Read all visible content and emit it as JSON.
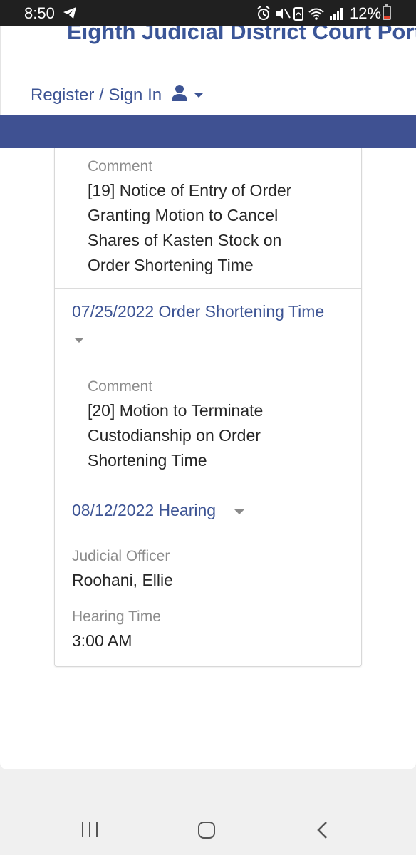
{
  "status_bar": {
    "time": "8:50",
    "battery": "12%",
    "icons": [
      "telegram-icon",
      "alarm-icon",
      "mute-icon",
      "nfc-icon",
      "wifi-icon",
      "signal-icon",
      "battery-icon"
    ]
  },
  "header": {
    "site_title": "Eighth Judicial District Court Portal",
    "signin_label": "Register / Sign In"
  },
  "colors": {
    "brand_blue": "#3f5192",
    "link_blue": "#3d5494"
  },
  "events": [
    {
      "comment_label": "Comment",
      "comment_lines": [
        "[19] Notice of Entry of Order",
        "Granting Motion to Cancel",
        "Shares of Kasten Stock on",
        "Order Shortening Time"
      ]
    },
    {
      "title": "07/25/2022 Order Shortening Time",
      "comment_label": "Comment",
      "comment_lines": [
        "[20] Motion to Terminate",
        "Custodianship on Order",
        "Shortening Time"
      ]
    },
    {
      "title": "08/12/2022 Hearing",
      "officer_label": "Judicial Officer",
      "officer_value": "Roohani, Ellie",
      "time_label": "Hearing Time",
      "time_value": "3:00 AM"
    }
  ]
}
